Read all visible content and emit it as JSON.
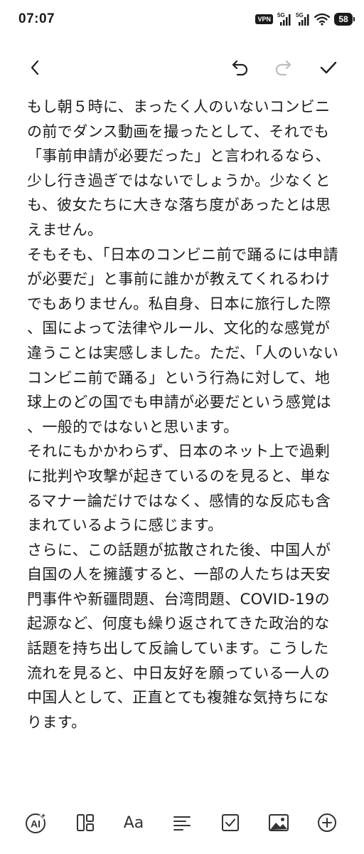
{
  "status_bar": {
    "time": "07:07",
    "vpn": "VPN",
    "network_1": "5G",
    "network_2": "5G",
    "battery": "58"
  },
  "toolbar": {
    "icons": [
      "back-icon",
      "undo-icon",
      "redo-icon",
      "check-icon"
    ],
    "redo_enabled": false
  },
  "editor": {
    "paragraphs": [
      "もし朝５時に、まったく人のいないコンビニの前でダンス動画を撮ったとして、それでも「事前申請が必要だった」と言われるなら、少し行き過ぎではないでしょうか。少なくとも、彼女たちに大きな落ち度があったとは思えません。",
      "そもそも、「日本のコンビニ前で踊るには申請が必要だ」と事前に誰かが教えてくれるわけでもありません。私自身、日本に旅行した際、国によって法律やルール、文化的な感覚が違うことは実感しました。ただ、「人のいないコンビニ前で踊る」という行為に対して、地球上のどの国でも申請が必要だという感覚は、一般的ではないと思います。",
      "それにもかかわらず、日本のネット上で過剰に批判や攻撃が起きているのを見ると、単なるマナー論だけではなく、感情的な反応も含まれているように感じます。",
      "さらに、この話題が拡散された後、中国人が自国の人を擁護すると、一部の人たちは天安門事件や新疆問題、台湾問題、COVID-19の起源など、何度も繰り返されてきた政治的な話題を持ち出して反論しています。こうした流れを見ると、中日友好を願っている一人の中国人として、正直とても複雑な気持ちになります。"
    ]
  },
  "format_bar": {
    "ai_label": "AI",
    "text_style_label": "Aa",
    "icons": [
      "ai-assist-icon",
      "layout-icon",
      "text-style-icon",
      "align-icon",
      "checkbox-icon",
      "image-icon",
      "add-icon"
    ]
  },
  "colors": {
    "text": "#1c1c1c",
    "icon": "#333333",
    "disabled_icon": "#bdbdbd",
    "background": "#ffffff"
  }
}
